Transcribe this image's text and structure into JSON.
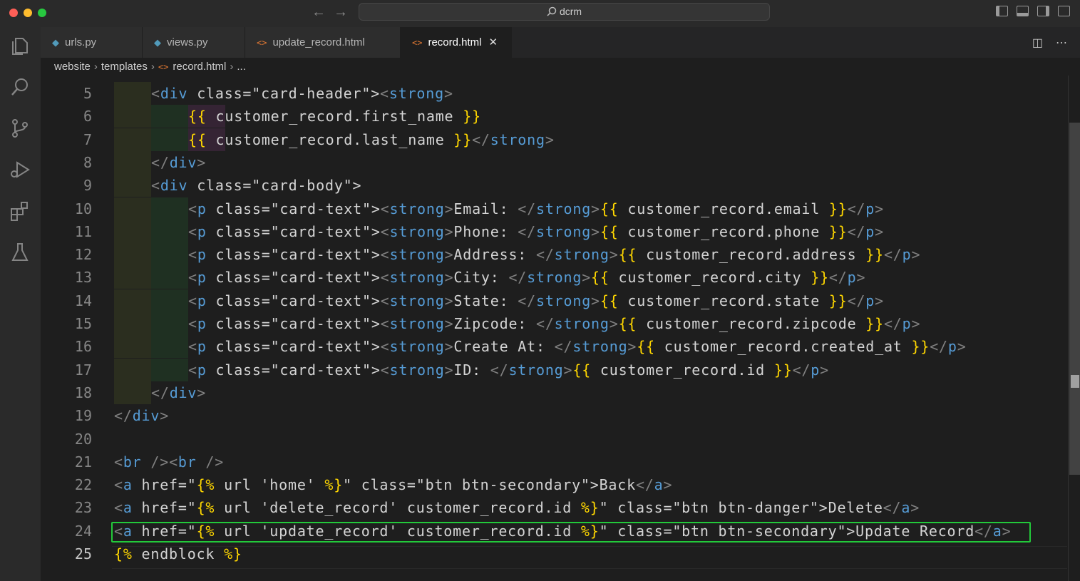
{
  "window": {
    "search_text": "dcrm"
  },
  "tabs": [
    {
      "label": "urls.py",
      "icon": "python-file-icon",
      "active": false
    },
    {
      "label": "views.py",
      "icon": "python-file-icon",
      "active": false
    },
    {
      "label": "update_record.html",
      "icon": "html-file-icon",
      "active": false
    },
    {
      "label": "record.html",
      "icon": "html-file-icon",
      "active": true
    }
  ],
  "tab_close_glyph": "✕",
  "breadcrumb": {
    "parts": [
      "website",
      "templates",
      "record.html",
      "..."
    ]
  },
  "editor": {
    "line_numbers": [
      "5",
      "6",
      "7",
      "8",
      "9",
      "10",
      "11",
      "12",
      "13",
      "14",
      "15",
      "16",
      "17",
      "18",
      "19",
      "20",
      "21",
      "22",
      "23",
      "24",
      "25"
    ],
    "current_line": "25",
    "highlighted_line": "24",
    "lines": [
      "<div class=\"card-header\"><strong>",
      "{{ customer_record.first_name }}",
      "{{ customer_record.last_name }}</strong>",
      "</div>",
      "<div class=\"card-body\">",
      "<p class=\"card-text\"><strong>Email: </strong>{{ customer_record.email }}</p>",
      "<p class=\"card-text\"><strong>Phone: </strong>{{ customer_record.phone }}</p>",
      "<p class=\"card-text\"><strong>Address: </strong>{{ customer_record.address }}</p>",
      "<p class=\"card-text\"><strong>City: </strong>{{ customer_record.city }}</p>",
      "<p class=\"card-text\"><strong>State: </strong>{{ customer_record.state }}</p>",
      "<p class=\"card-text\"><strong>Zipcode: </strong>{{ customer_record.zipcode }}</p>",
      "<p class=\"card-text\"><strong>Create At: </strong>{{ customer_record.created_at }}</p>",
      "<p class=\"card-text\"><strong>ID: </strong>{{ customer_record.id }}</p>",
      "</div>",
      "</div>",
      "",
      "<br /><br />",
      "<a href=\"{% url 'home' %}\" class=\"btn btn-secondary\">Back</a>",
      "<a href=\"{% url 'delete_record' customer_record.id %}\" class=\"btn btn-danger\">Delete</a>",
      "<a href=\"{% url 'update_record' customer_record.id %}\" class=\"btn btn-secondary\">Update Record</a>",
      "{% endblock %}"
    ]
  },
  "colors": {
    "highlight_box": "#22c93a",
    "tag_name": "#569cd6",
    "attr_name": "#9cdcfe",
    "attr_value": "#ce9178",
    "template_brace": "#ffd700"
  }
}
